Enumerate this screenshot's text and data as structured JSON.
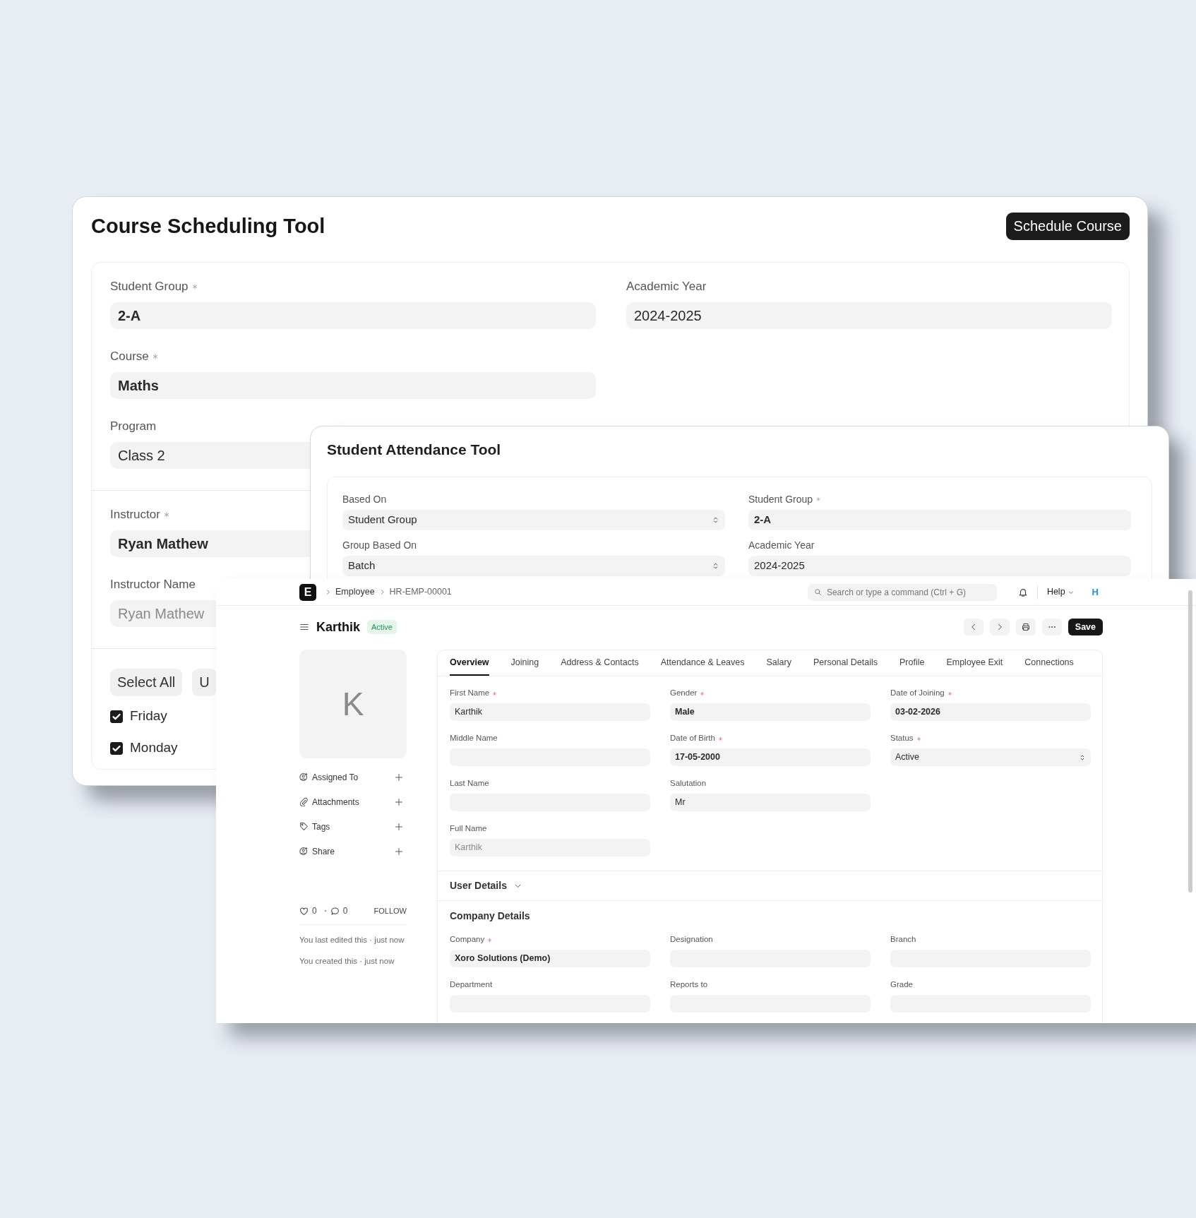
{
  "course_scheduling_tool": {
    "title": "Course Scheduling Tool",
    "action_button": "Schedule Course",
    "fields_left": [
      {
        "label": "Student Group",
        "required": true,
        "kind": "link",
        "value": "2-A"
      },
      {
        "label": "Course",
        "required": true,
        "kind": "link",
        "value": "Maths"
      },
      {
        "label": "Program",
        "required": false,
        "kind": "data",
        "value": "Class 2"
      }
    ],
    "fields_right": [
      {
        "label": "Academic Year",
        "required": false,
        "kind": "data",
        "value": "2024-2025"
      }
    ],
    "instructor_fields": [
      {
        "label": "Instructor",
        "required": true,
        "kind": "link",
        "value": "Ryan Mathew"
      },
      {
        "label": "Instructor Name",
        "required": false,
        "kind": "readonly",
        "value": "Ryan Mathew"
      }
    ],
    "buttons": [
      "Select All",
      "U"
    ],
    "days": [
      {
        "label": "Friday",
        "checked": true
      },
      {
        "label": "Monday",
        "checked": true
      }
    ]
  },
  "student_attendance_tool": {
    "title": "Student Attendance Tool",
    "fields_left": [
      {
        "label": "Based On",
        "required": false,
        "kind": "select",
        "value": "Student Group"
      },
      {
        "label": "Group Based On",
        "required": false,
        "kind": "select",
        "value": "Batch"
      }
    ],
    "fields_right": [
      {
        "label": "Student Group",
        "required": true,
        "kind": "link",
        "value": "2-A"
      },
      {
        "label": "Academic Year",
        "required": false,
        "kind": "data",
        "value": "2024-2025"
      }
    ]
  },
  "employee_form": {
    "logo": "E",
    "breadcrumbs": [
      "Employee",
      "HR-EMP-00001"
    ],
    "search": {
      "placeholder": "Search or type a command (Ctrl + G)"
    },
    "help": "Help",
    "user_initial": "H",
    "title": "Karthik",
    "status": "Active",
    "save_button": "Save",
    "avatar_initial": "K",
    "sidebar_items": [
      {
        "label": "Assigned To",
        "kind": "assign"
      },
      {
        "label": "Attachments",
        "kind": "attachment"
      },
      {
        "label": "Tags",
        "kind": "tag"
      },
      {
        "label": "Share",
        "kind": "share"
      }
    ],
    "likes": "0",
    "comments": "0",
    "follow": "FOLLOW",
    "activity": [
      "You last edited this · just now",
      "You created this · just now"
    ],
    "tabs": [
      {
        "label": "Overview",
        "selected": true
      },
      {
        "label": "Joining",
        "selected": false
      },
      {
        "label": "Address & Contacts",
        "selected": false
      },
      {
        "label": "Attendance & Leaves",
        "selected": false
      },
      {
        "label": "Salary",
        "selected": false
      },
      {
        "label": "Personal Details",
        "selected": false
      },
      {
        "label": "Profile",
        "selected": false
      },
      {
        "label": "Employee Exit",
        "selected": false
      },
      {
        "label": "Connections",
        "selected": false
      }
    ],
    "overview_columns": [
      [
        {
          "label": "First Name",
          "required": true,
          "kind": "data",
          "value": "Karthik"
        },
        {
          "label": "Middle Name",
          "required": false,
          "kind": "data"
        },
        {
          "label": "Last Name",
          "required": false,
          "kind": "data"
        },
        {
          "label": "Full Name",
          "required": false,
          "kind": "readonly",
          "value": "Karthik"
        }
      ],
      [
        {
          "label": "Gender",
          "required": true,
          "kind": "link",
          "value": "Male"
        },
        {
          "label": "Date of Birth",
          "required": true,
          "kind": "link",
          "value": "17-05-2000"
        },
        {
          "label": "Salutation",
          "required": false,
          "kind": "data",
          "value": "Mr"
        }
      ],
      [
        {
          "label": "Date of Joining",
          "required": true,
          "kind": "link",
          "value": "03-02-2026"
        },
        {
          "label": "Status",
          "required": true,
          "kind": "select",
          "value": "Active"
        }
      ]
    ],
    "sections": [
      {
        "title": "User Details",
        "expanded": false
      },
      {
        "title": "Company Details",
        "columns": [
          [
            {
              "label": "Company",
              "required": true,
              "kind": "link",
              "value": "Xoro Solutions (Demo)"
            },
            {
              "label": "Department",
              "required": false,
              "kind": "link"
            }
          ],
          [
            {
              "label": "Designation",
              "required": false,
              "kind": "link"
            },
            {
              "label": "Reports to",
              "required": false,
              "kind": "link"
            }
          ],
          [
            {
              "label": "Branch",
              "required": false,
              "kind": "link"
            },
            {
              "label": "Grade",
              "required": false,
              "kind": "link"
            }
          ]
        ]
      }
    ]
  }
}
